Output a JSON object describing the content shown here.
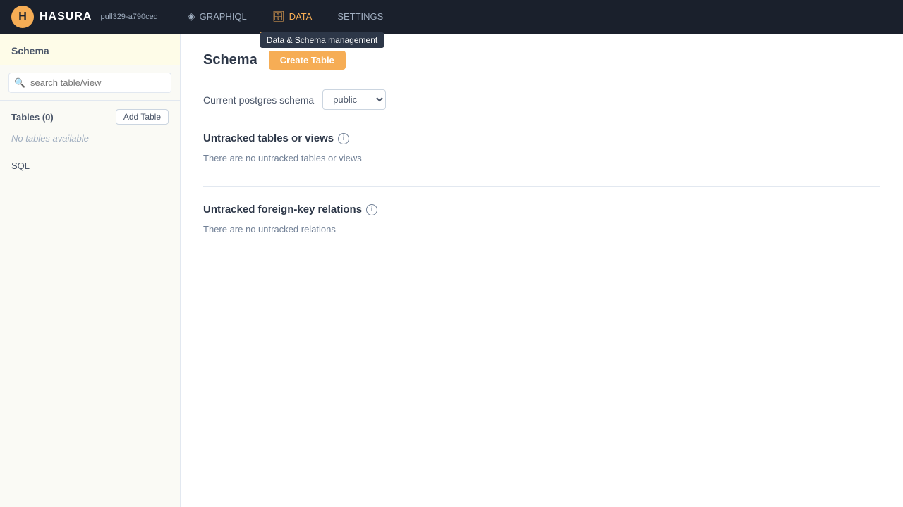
{
  "app": {
    "logo_icon": "H",
    "brand": "HASURA",
    "version": "pull329-a790ced"
  },
  "topnav": {
    "tabs": [
      {
        "id": "graphiql",
        "label": "GRAPHIQL",
        "icon": "◈",
        "active": false
      },
      {
        "id": "data",
        "label": "DATA",
        "icon": "🗄",
        "active": true
      },
      {
        "id": "settings",
        "label": "SETTINGS",
        "icon": "",
        "active": false
      }
    ],
    "tooltip": "Data & Schema management",
    "tooltip_visible": true
  },
  "sidebar": {
    "section_label": "Schema",
    "search_placeholder": "search table/view",
    "tables_label": "Tables (0)",
    "add_table_label": "Add Table",
    "no_tables_text": "No tables available",
    "sql_label": "SQL"
  },
  "main": {
    "page_title": "Schema",
    "create_table_label": "Create Table",
    "schema_row_label": "Current postgres schema",
    "schema_options": [
      "public"
    ],
    "schema_selected": "public",
    "untracked_views_title": "Untracked tables or views",
    "untracked_views_empty": "There are no untracked tables or views",
    "untracked_relations_title": "Untracked foreign-key relations",
    "untracked_relations_empty": "There are no untracked relations"
  }
}
